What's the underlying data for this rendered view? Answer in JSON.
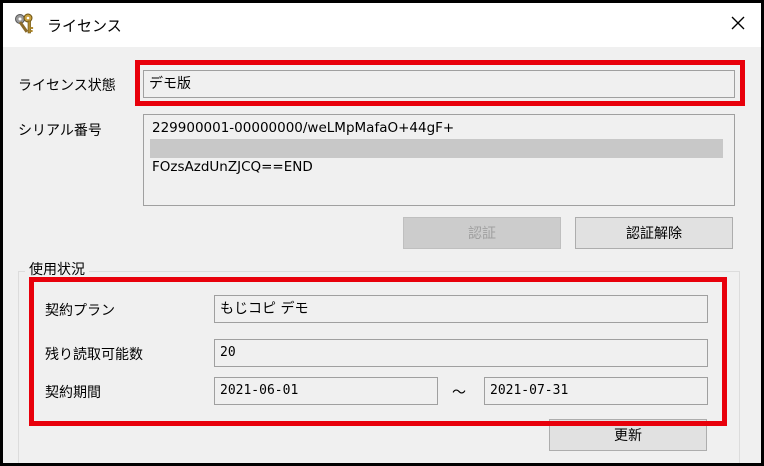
{
  "window": {
    "title": "ライセンス",
    "title_icon": "key-icon",
    "close_icon": "close-icon"
  },
  "license": {
    "status_label": "ライセンス状態",
    "status_value": "デモ版",
    "serial_label": "シリアル番号",
    "serial_line1": "229900001-00000000/weLMpMafaO+44gF+",
    "serial_line3": "FOzsAzdUnZJCQ==END",
    "auth_button": "認証",
    "unauth_button": "認証解除"
  },
  "usage": {
    "group_title": "使用状況",
    "plan_label": "契約プラン",
    "plan_value": "もじコピ デモ",
    "remaining_label": "残り読取可能数",
    "remaining_value": "20",
    "period_label": "契約期間",
    "period_start": "2021-06-01",
    "period_separator": "～",
    "period_end": "2021-07-31",
    "refresh_button": "更新"
  },
  "colors": {
    "highlight": "#e8000b",
    "window_bg": "#f0f0f0"
  }
}
